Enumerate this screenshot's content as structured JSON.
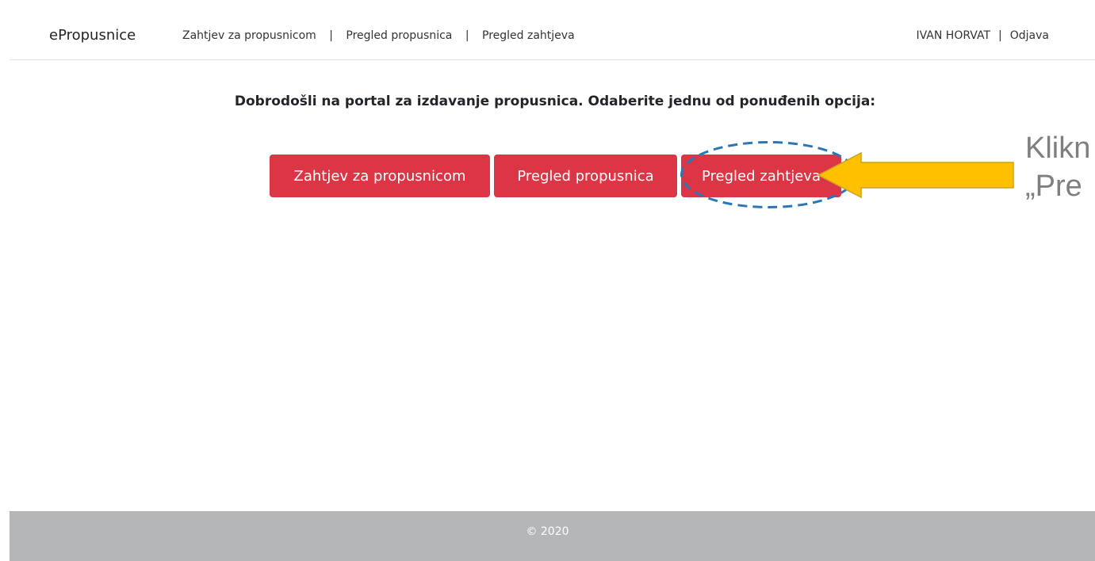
{
  "navbar": {
    "brand": "ePropusnice",
    "links": [
      {
        "label": "Zahtjev za propusnicom"
      },
      {
        "label": "Pregled propusnica"
      },
      {
        "label": "Pregled zahtjeva"
      }
    ],
    "separator": "|",
    "user_name": "IVAN HORVAT",
    "logout_label": "Odjava"
  },
  "main": {
    "welcome_text": "Dobrodošli na portal za izdavanje propusnica. Odaberite jednu od ponuđenih opcija:",
    "buttons": [
      {
        "label": "Zahtjev za propusnicom"
      },
      {
        "label": "Pregled propusnica"
      },
      {
        "label": "Pregled zahtjeva"
      }
    ]
  },
  "annotation": {
    "callout_line1": "Klikn",
    "callout_line2": "„Pre",
    "arrow_color": "#ffc000",
    "ellipse_color": "#2e75b6"
  },
  "footer": {
    "text": "© 2020"
  },
  "colors": {
    "button_bg": "#dc3545",
    "footer_bg": "#b5b6b8"
  }
}
